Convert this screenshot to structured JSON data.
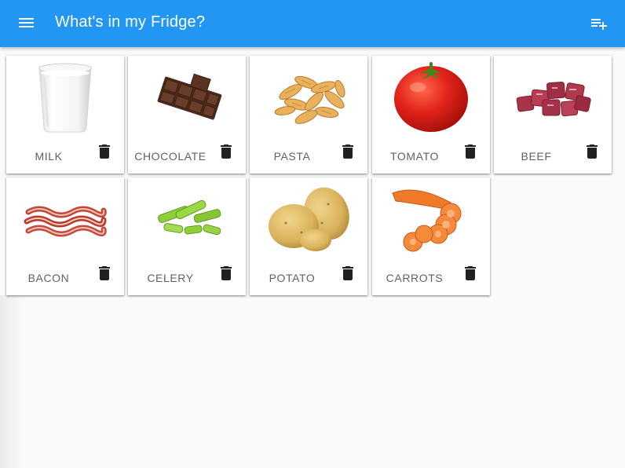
{
  "appbar": {
    "title": "What's in my Fridge?",
    "menu_icon": "menu-icon",
    "action_icon": "playlist-add-icon",
    "color": "#2196f3"
  },
  "items": [
    {
      "label": "MILK",
      "image": "milk-glass-image"
    },
    {
      "label": "CHOCOLATE",
      "image": "chocolate-bar-image"
    },
    {
      "label": "PASTA",
      "image": "fusilli-pasta-image"
    },
    {
      "label": "TOMATO",
      "image": "tomato-image"
    },
    {
      "label": "BEEF",
      "image": "beef-cubes-image"
    },
    {
      "label": "BACON",
      "image": "bacon-strips-image"
    },
    {
      "label": "CELERY",
      "image": "celery-sticks-image"
    },
    {
      "label": "POTATO",
      "image": "potatoes-image"
    },
    {
      "label": "CARROTS",
      "image": "carrot-slices-image"
    }
  ],
  "delete_icon": "trash-icon"
}
